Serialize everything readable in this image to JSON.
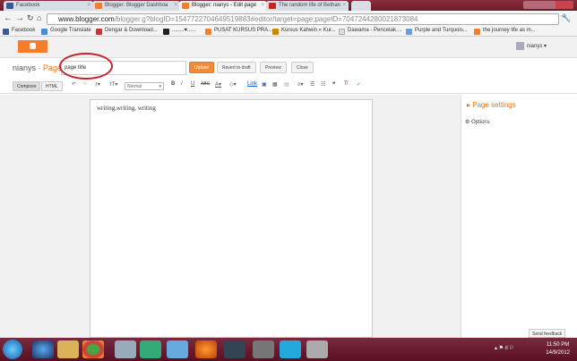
{
  "browser": {
    "tabs": [
      {
        "label": "Facebook",
        "color": "#3b5998",
        "active": false
      },
      {
        "label": "Blogger: Blogger Dashboa",
        "color": "#f57d2b",
        "active": false
      },
      {
        "label": "Blogger: nianys - Edit page",
        "color": "#f57d2b",
        "active": true
      },
      {
        "label": "The random life of Bethan",
        "color": "#cc2222",
        "active": false
      }
    ],
    "url_host": "www.blogger.com",
    "url_rest": "/blogger.g?blogID=1547722704649519883#editor/target=page;pageID=7047244280021873084",
    "bookmarks": [
      {
        "label": "Facebook",
        "color": "#3b5998"
      },
      {
        "label": "Google Translate",
        "color": "#4a8ad8"
      },
      {
        "label": "Dengar & Download...",
        "color": "#c33"
      },
      {
        "label": "........♥......",
        "color": "#222"
      },
      {
        "label": "PUSAT KURSUS PRA...",
        "color": "#f57d2b"
      },
      {
        "label": "Kursus Kahwin « Kur...",
        "color": "#c80"
      },
      {
        "label": "Dawama - Pencetak ...",
        "color": "#ddd"
      },
      {
        "label": "Purple and Turquois...",
        "color": "#6aa0d8"
      },
      {
        "label": "the journey life as m...",
        "color": "#f57d2b"
      }
    ]
  },
  "blogger": {
    "user": "nianys",
    "blog_name": "nianys",
    "separator": " · ",
    "section": "Page",
    "page_title": "page title",
    "buttons": {
      "update": "Update",
      "revert": "Revert to draft",
      "preview": "Preview",
      "close": "Close"
    },
    "modes": {
      "compose": "Compose",
      "html": "HTML"
    },
    "format_select": "Normal",
    "link_label": "Link",
    "editor_text": "writing,writing, writing",
    "sidebar": {
      "title": "Page settings",
      "options": "Options"
    },
    "send_feedback": "Send feedback"
  },
  "taskbar": {
    "time": "11:50 PM",
    "date": "14/9/2012"
  }
}
